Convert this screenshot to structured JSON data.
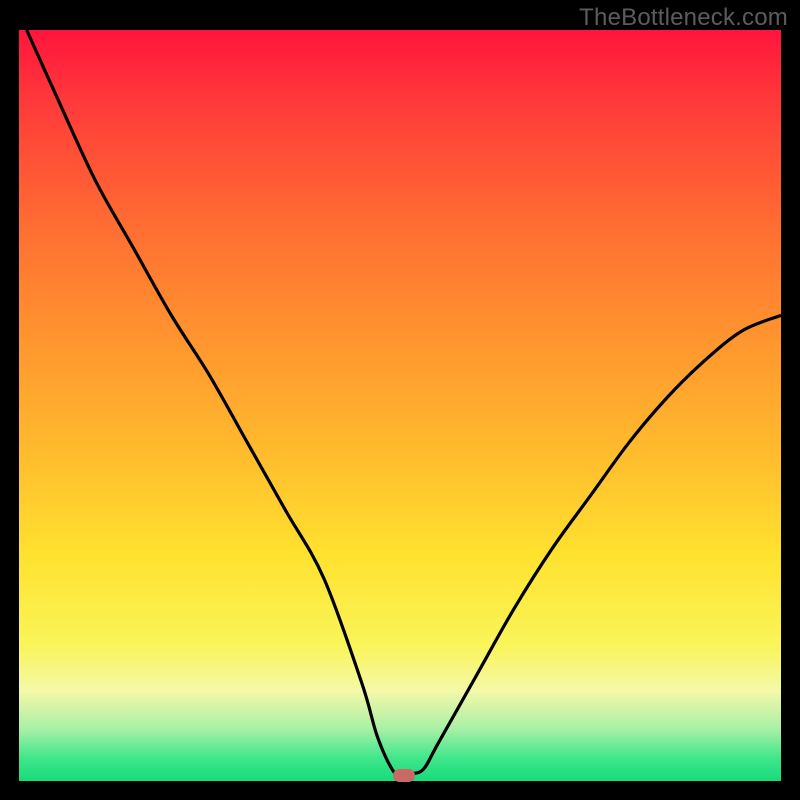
{
  "watermark": "TheBottleneck.com",
  "colors": {
    "background": "#000000",
    "watermark_text": "#5c5c5c",
    "curve": "#000000",
    "marker": "#c86964",
    "gradient_top": "#ff153c",
    "gradient_bottom": "#16db7a"
  },
  "chart_data": {
    "type": "line",
    "title": "",
    "xlabel": "",
    "ylabel": "",
    "xlim": [
      0,
      100
    ],
    "ylim": [
      0,
      100
    ],
    "grid": false,
    "legend": false,
    "series": [
      {
        "name": "bottleneck-curve",
        "x": [
          1,
          5,
          10,
          15,
          20,
          25,
          30,
          35,
          40,
          45,
          47,
          49,
          50,
          51,
          53,
          55,
          60,
          65,
          70,
          75,
          80,
          85,
          90,
          95,
          100
        ],
        "y": [
          100,
          91,
          80,
          71,
          62,
          54,
          45,
          36,
          27,
          13,
          6,
          1.5,
          1,
          1,
          1.5,
          5,
          14,
          23,
          31,
          38,
          45,
          51,
          56,
          60,
          62
        ]
      }
    ],
    "marker": {
      "x": 50.5,
      "y": 0.8
    },
    "annotations": []
  }
}
